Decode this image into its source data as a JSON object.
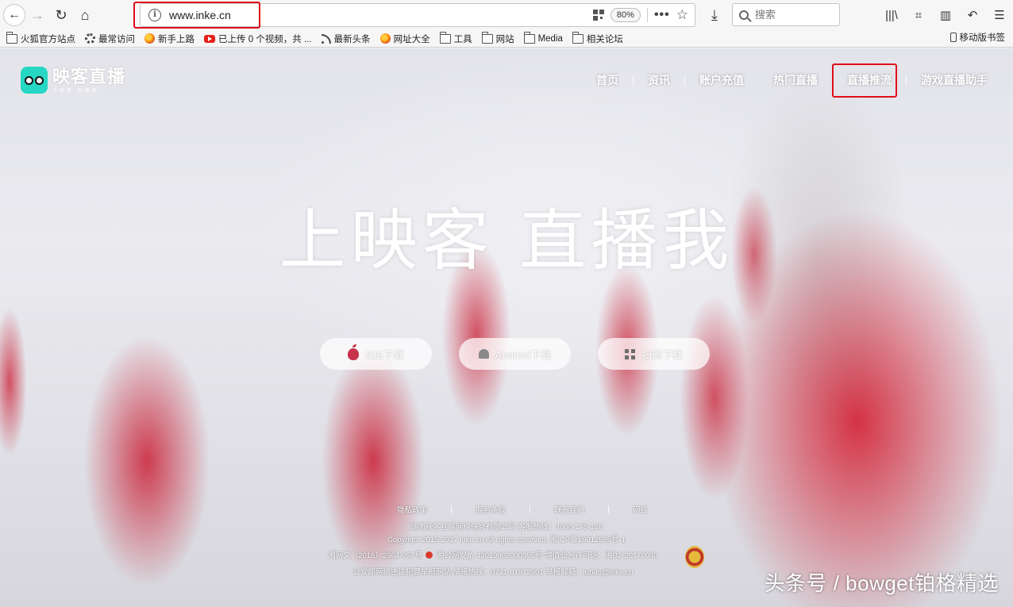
{
  "browser": {
    "url": "www.inke.cn",
    "zoom": "80%",
    "search_placeholder": "搜索",
    "more": "•••",
    "bookmarks": [
      {
        "label": "火狐官方站点",
        "icon": "folder-icon"
      },
      {
        "label": "最常访问",
        "icon": "gear-icon"
      },
      {
        "label": "新手上路",
        "icon": "firefox-icon"
      },
      {
        "label": "已上传 0 个视频，共 ...",
        "icon": "youtube-icon"
      },
      {
        "label": "最新头条",
        "icon": "rss-icon"
      },
      {
        "label": "网址大全",
        "icon": "firefox-icon"
      },
      {
        "label": "工具",
        "icon": "folder-icon"
      },
      {
        "label": "网站",
        "icon": "folder-icon"
      },
      {
        "label": "Media",
        "icon": "folder-icon"
      },
      {
        "label": "相关论坛",
        "icon": "folder-icon"
      }
    ],
    "mobile_bookmarks": "移动版书签",
    "highlight_color": "#e00d1a"
  },
  "site": {
    "logo_name": "映客直播",
    "logo_sub": "上映客 直播我",
    "logo_color": "#26d7c3",
    "nav": [
      "首页",
      "资讯",
      "账户充值",
      "热门直播",
      "直播推流",
      "游戏直播助手"
    ],
    "hero": "上映客 直播我",
    "downloads": {
      "ios": "IOS下载",
      "android": "Android下载",
      "qr": "扫码下载"
    },
    "footer_links": [
      "隐私政策",
      "服务条款",
      "联系我们",
      "网红"
    ],
    "footer": {
      "line1": "湖南映客互娱网络信息有限公司   客服热线：4008-178-168",
      "line2": "Copyright 2015-2017 inke.cn All rights reserved. 湘ICP备16012585号-1",
      "line3a": "湘网文（2016）2964-057号",
      "line3b": "湘公网安备 43019002000355号 增值业务许可证：湘B2-20170040",
      "line4": "公安部网络违法犯罪举报网站 举报热线：0731-81872901 举报邮箱：jubao@inke.cn"
    }
  },
  "watermark": "头条号 / bowget铂格精选"
}
